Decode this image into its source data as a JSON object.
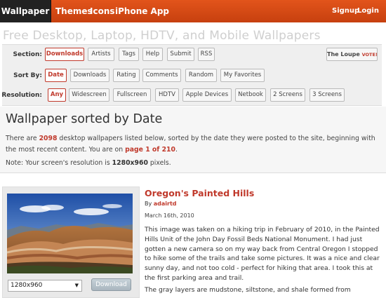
{
  "topbar": {
    "brand": "Wallpaper",
    "nav": [
      "Themes",
      "Icons",
      "iPhone App"
    ],
    "signup": "Signup",
    "login": "Login"
  },
  "site_heading": "Free Desktop, Laptop, HDTV, and Mobile Wallpapers",
  "filters": {
    "section": {
      "label": "Section:",
      "items": [
        "Downloads",
        "Artists",
        "Tags",
        "Help",
        "Submit",
        "RSS"
      ],
      "active": "Downloads",
      "loupe": "The Loupe",
      "loupe_vote": "VOTE!"
    },
    "sort_by": {
      "label": "Sort By:",
      "items": [
        "Date",
        "Downloads",
        "Rating",
        "Comments",
        "Random",
        "My Favorites"
      ],
      "active": "Date"
    },
    "resolution": {
      "label": "Resolution:",
      "items": [
        "Any",
        "Widescreen",
        "Fullscreen",
        "HDTV",
        "Apple Devices",
        "Netbook",
        "2 Screens",
        "3 Screens"
      ],
      "active": "Any"
    }
  },
  "page_title": "Wallpaper sorted by Date",
  "intro": {
    "p1": "There are ",
    "count": "2098",
    "p2": " desktop wallpapers listed below, sorted by the date they were posted to the site, beginning with the most recent content. You are on ",
    "page": "page 1 of 210",
    "p3": "."
  },
  "note": {
    "p1": "Note: Your screen's resolution is ",
    "res": "1280x960",
    "p2": " pixels."
  },
  "wallpaper": {
    "title": "Oregon's Painted Hills",
    "by": "By ",
    "author": "adairtd",
    "date": "March 16th, 2010",
    "description": "This image was taken on a hiking trip in February of 2010, in the Painted Hills Unit of the John Day Fossil Beds National Monument. I had just gotten a new camera so on my way back from Central Oregon I stopped to hike some of the trails and take some pictures. It was a nice and clear sunny day, and not too cold - perfect for hiking that area. I took this at the first parking area and trail.",
    "description2": "The gray layers are mudstone, siltstone, and shale formed from",
    "resolution_value": "1280x960",
    "download_label": "Download"
  },
  "colors": {
    "accent": "#c0392b",
    "topbar": "#d94a14",
    "brand_bg": "#222222"
  }
}
